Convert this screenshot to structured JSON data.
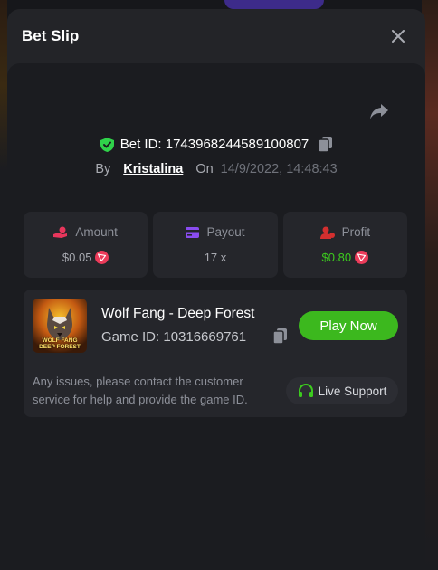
{
  "modal": {
    "title": "Bet Slip"
  },
  "bet": {
    "id_label": "Bet ID: 1743968244589100807",
    "by_label": "By",
    "username": "Kristalina",
    "on_label": "On",
    "datetime": "14/9/2022, 14:48:43"
  },
  "stats": [
    {
      "label": "Amount",
      "value": "$0.05",
      "icon": "hand-coin-icon",
      "color": "#e8365c"
    },
    {
      "label": "Payout",
      "value": "17 x",
      "icon": "card-icon",
      "color": "#8a4cf0"
    },
    {
      "label": "Profit",
      "value": "$0.80",
      "icon": "user-coin-icon",
      "color": "#d32f2f"
    }
  ],
  "game": {
    "name": "Wolf Fang - Deep Forest",
    "id_label": "Game ID: 10316669761",
    "thumb_line1": "WOLF FANG",
    "thumb_line2": "DEEP FOREST",
    "play_label": "Play Now"
  },
  "support": {
    "help_text": "Any issues, please contact the customer service for help and provide the game ID.",
    "button_label": "Live Support"
  },
  "colors": {
    "accent_green": "#3cb81e",
    "profit_green": "#3ccb1e",
    "shield_green": "#2fd24a",
    "tron_red": "#eb3b5a"
  }
}
